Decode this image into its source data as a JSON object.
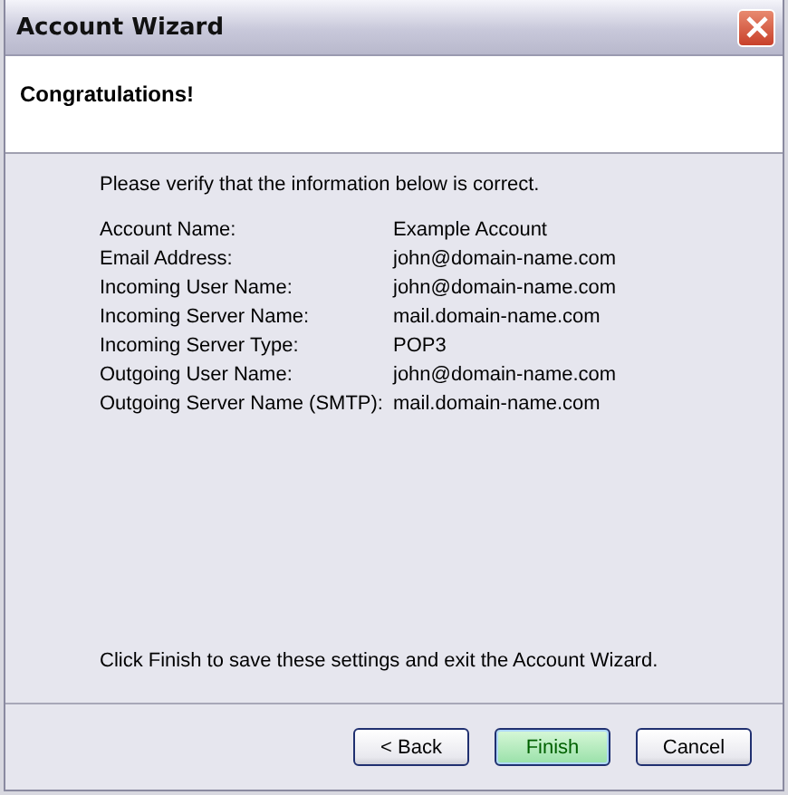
{
  "window": {
    "title": "Account Wizard"
  },
  "header": {
    "title": "Congratulations!"
  },
  "intro": "Please verify that the information below is correct.",
  "details": [
    {
      "label": "Account Name:",
      "value": "Example Account"
    },
    {
      "label": "Email Address:",
      "value": "john@domain-name.com"
    },
    {
      "label": "Incoming User Name:",
      "value": "john@domain-name.com"
    },
    {
      "label": "Incoming Server Name:",
      "value": "mail.domain-name.com"
    },
    {
      "label": "Incoming Server Type:",
      "value": "POP3"
    },
    {
      "label": "Outgoing User Name:",
      "value": "john@domain-name.com"
    },
    {
      "label": "Outgoing Server Name (SMTP):",
      "value": "mail.domain-name.com"
    }
  ],
  "note": "Click Finish to save these settings and exit the Account Wizard.",
  "buttons": [
    {
      "label": "< Back",
      "default": false
    },
    {
      "label": "Finish",
      "default": true
    },
    {
      "label": "Cancel",
      "default": false
    }
  ]
}
